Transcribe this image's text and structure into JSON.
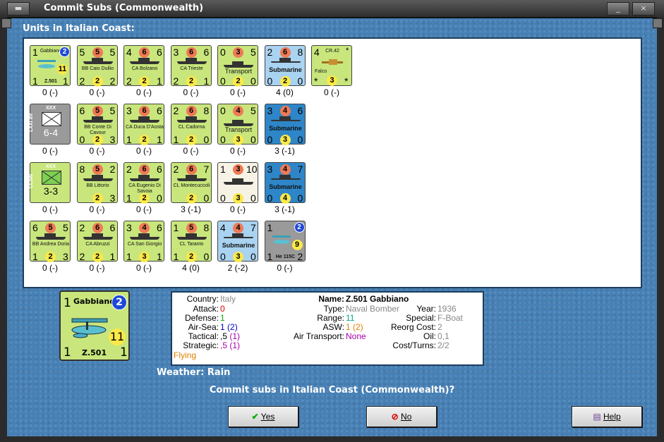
{
  "window": {
    "title": "Commit Subs (Commonwealth)"
  },
  "units_label": "Units in Italian Coast:",
  "units": [
    {
      "nums": [
        "1",
        "",
        "2"
      ],
      "name": "Gabbiano",
      "sub": "Z.501",
      "mid": "11",
      "br": [
        "1",
        "",
        "1"
      ],
      "status": "0 (-)",
      "type": "plane",
      "color": "green"
    },
    {
      "nums": [
        "5",
        "5",
        "5"
      ],
      "name": "BB Caio Duilio",
      "br": [
        "2",
        "2",
        "2"
      ],
      "status": "0 (-)",
      "type": "ship",
      "color": "green"
    },
    {
      "nums": [
        "4",
        "6",
        "6"
      ],
      "name": "CA Bolzano",
      "br": [
        "2",
        "2",
        "1"
      ],
      "status": "0 (-)",
      "type": "ship",
      "color": "green"
    },
    {
      "nums": [
        "3",
        "6",
        "6"
      ],
      "name": "CA Trieste",
      "br": [
        "2",
        "2",
        "1"
      ],
      "status": "0 (-)",
      "type": "ship",
      "color": "green"
    },
    {
      "nums": [
        "0",
        "3",
        "5"
      ],
      "name": "Transport",
      "br": [
        "0",
        "2",
        "0"
      ],
      "status": "0 (-)",
      "type": "transport",
      "color": "green"
    },
    {
      "nums": [
        "2",
        "6",
        "8"
      ],
      "name": "Submarine",
      "br": [
        "0",
        "2",
        "0"
      ],
      "status": "4 (0)",
      "type": "sub",
      "color": "ltblue"
    },
    {
      "nums": [
        "4",
        "CR.42",
        "*"
      ],
      "name": "Falco",
      "br": [
        "*",
        "3",
        "*"
      ],
      "status": "0 (-)",
      "type": "fighter",
      "color": "green"
    },
    {
      "nums": [
        "LXXI Inf",
        "XXX",
        ""
      ],
      "name": "6-4",
      "br": [
        "",
        "",
        ""
      ],
      "status": "0 (-)",
      "type": "army",
      "color": "grey"
    },
    {
      "nums": [
        "6",
        "5",
        "5"
      ],
      "name": "BB Conte Di Cavour",
      "br": [
        "0",
        "2",
        "3"
      ],
      "status": "0 (-)",
      "type": "ship",
      "color": "green"
    },
    {
      "nums": [
        "3",
        "6",
        "6"
      ],
      "name": "CA Duca D'Aosta",
      "br": [
        "1",
        "2",
        "1"
      ],
      "status": "0 (-)",
      "type": "ship",
      "color": "green"
    },
    {
      "nums": [
        "2",
        "6",
        "8"
      ],
      "name": "CL Cadorna",
      "br": [
        "1",
        "2",
        "0"
      ],
      "status": "0 (-)",
      "type": "ship",
      "color": "green"
    },
    {
      "nums": [
        "0",
        "4",
        "5"
      ],
      "name": "Transport",
      "br": [
        "0",
        "3",
        "0"
      ],
      "status": "0 (-)",
      "type": "transport",
      "color": "green"
    },
    {
      "nums": [
        "3",
        "4",
        "6"
      ],
      "name": "Submarine",
      "br": [
        "0",
        "3",
        "0"
      ],
      "status": "3 (-1)",
      "type": "sub",
      "color": "blue"
    },
    {
      "nums": [
        "CCNN",
        "XXX",
        ""
      ],
      "name": "3-3",
      "br": [
        "",
        "",
        ""
      ],
      "status": "0 (-)",
      "type": "army",
      "color": "green"
    },
    {
      "nums": [
        "8",
        "5",
        "2"
      ],
      "name": "BB Littorio",
      "br": [
        "",
        "2",
        "3"
      ],
      "status": "0 (-)",
      "type": "ship",
      "color": "green"
    },
    {
      "nums": [
        "2",
        "6",
        "6"
      ],
      "name": "CA Eugenio Di Savoia",
      "br": [
        "1",
        "2",
        "0"
      ],
      "status": "0 (-)",
      "type": "ship",
      "color": "green"
    },
    {
      "nums": [
        "2",
        "6",
        "7"
      ],
      "name": "CL Montecuccoli",
      "br": [
        "",
        "2",
        "0"
      ],
      "status": "3 (-1)",
      "type": "ship",
      "color": "green"
    },
    {
      "nums": [
        "1",
        "3",
        "10"
      ],
      "name": "",
      "br": [
        "0",
        "3",
        "0"
      ],
      "status": "0 (-)",
      "type": "transport",
      "color": "beige"
    },
    {
      "nums": [
        "3",
        "4",
        "7"
      ],
      "name": "Submarine",
      "br": [
        "0",
        "4",
        "0"
      ],
      "status": "3 (-1)",
      "type": "sub",
      "color": "blue"
    },
    {
      "nums": [
        "6",
        "5",
        "5"
      ],
      "name": "BB Andrea Doria",
      "br": [
        "1",
        "2",
        "3"
      ],
      "status": "0 (-)",
      "type": "ship",
      "color": "green"
    },
    {
      "nums": [
        "2",
        "6",
        "6"
      ],
      "name": "CA Abruzzi",
      "br": [
        "2",
        "2",
        "1"
      ],
      "status": "0 (-)",
      "type": "ship",
      "color": "green"
    },
    {
      "nums": [
        "3",
        "4",
        "6"
      ],
      "name": "CA San Giorgio",
      "br": [
        "1",
        "3",
        "1"
      ],
      "status": "0 (-)",
      "type": "ship",
      "color": "green"
    },
    {
      "nums": [
        "1",
        "5",
        "8"
      ],
      "name": "CL Taranto",
      "br": [
        "1",
        "2",
        "0"
      ],
      "status": "4 (0)",
      "type": "ship",
      "color": "green"
    },
    {
      "nums": [
        "4",
        "4",
        "7"
      ],
      "name": "Submarine",
      "br": [
        "0",
        "3",
        "0"
      ],
      "status": "2 (-2)",
      "type": "sub",
      "color": "ltblue"
    },
    {
      "nums": [
        "1",
        "",
        "2"
      ],
      "name": "",
      "sub": "He 115C",
      "mid": "9",
      "br": [
        "1",
        "",
        "2"
      ],
      "status": "0 (-)",
      "type": "plane",
      "color": "grey"
    }
  ],
  "selected": {
    "name_label": "Gabbiano",
    "badge": "2",
    "tl": "1",
    "mid": "11",
    "bl": "1",
    "sub": "Z.501",
    "br": "1"
  },
  "info": {
    "country_l": "Country:",
    "country_v": "Italy",
    "attack_l": "Attack:",
    "attack_v": "0",
    "defense_l": "Defense:",
    "defense_v": "1",
    "airsea_l": "Air-Sea:",
    "airsea_v": "1",
    "airsea_p": "(2)",
    "tactical_l": "Tactical:",
    "tactical_v": ",5",
    "tactical_p": "(1)",
    "strategic_l": "Strategic:",
    "strategic_v": ",5",
    "strategic_p": "(1)",
    "flying": "Flying",
    "name_l": "Name:",
    "name_v": "Z.501 Gabbiano",
    "type_l": "Type:",
    "type_v": "Naval Bomber",
    "year_l": "Year:",
    "year_v": "1936",
    "range_l": "Range:",
    "range_v": "11",
    "special_l": "Special:",
    "special_v": "F-Boat",
    "asw_l": "ASW:",
    "asw_v": "1 (2)",
    "reorg_l": "Reorg Cost:",
    "reorg_v": "2",
    "airtrans_l": "Air Transport:",
    "airtrans_v": "None",
    "oil_l": "Oil:",
    "oil_v": "0,1",
    "cost_l": "Cost/Turns:",
    "cost_v": "2/2"
  },
  "weather": "Weather: Rain",
  "prompt": "Commit subs in Italian Coast (Commonwealth)?",
  "buttons": {
    "yes": "Yes",
    "no": "No",
    "help": "Help"
  },
  "colors": {
    "green": "#c8e67c",
    "blue": "#2e86c8",
    "ltblue": "#a9d3f0",
    "red": "#ef7a55",
    "yellow": "#fbe94a"
  }
}
